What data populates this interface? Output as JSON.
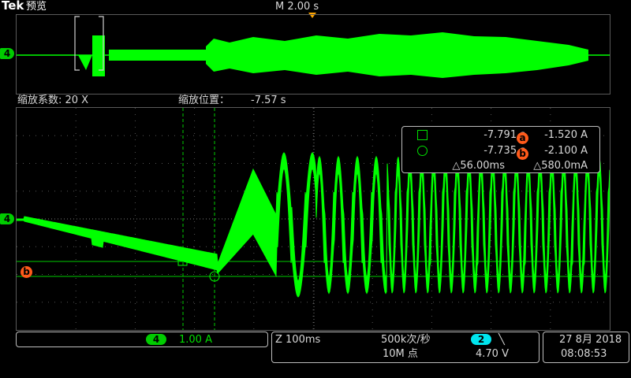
{
  "brand": {
    "logo": "Tek",
    "mode": "预览"
  },
  "header": {
    "timebase": "M 2.00 s"
  },
  "zoom": {
    "factor_label": "缩放系数: 20 X",
    "position_label": "缩放位置：",
    "position_value": "-7.57 s"
  },
  "channel_marker": "4",
  "ref_marker": "b",
  "measure": {
    "row1": {
      "time": "-7.791 s",
      "badge": "a",
      "value": "-1.520 A"
    },
    "row2": {
      "time": "-7.735 s",
      "badge": "b",
      "value": "-2.100 A"
    },
    "row3": {
      "delta_time": "△56.00ms",
      "delta_value": "△580.0mA"
    }
  },
  "status": {
    "channel": "4",
    "scale": "1.00 A",
    "zoom_time": "Z 100ms",
    "sample_rate": "500k次/秒",
    "record": "10M 点",
    "trig_channel": "2",
    "trig_slope": "╲",
    "trig_level": "4.70 V",
    "date": "27 8月 2018",
    "time": "08:08:53"
  },
  "colors": {
    "trace": "#00ff00",
    "accent": "#ff5a1a",
    "trigger": "#ffa500",
    "marker_bg": "#00cc00"
  }
}
